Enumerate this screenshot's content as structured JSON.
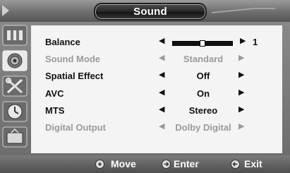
{
  "window": {
    "title": "Sound"
  },
  "sidebar": {
    "icons": [
      {
        "name": "picture-icon"
      },
      {
        "name": "sound-icon",
        "active": true
      },
      {
        "name": "setup-tools-icon"
      },
      {
        "name": "clock-icon"
      },
      {
        "name": "tv-icon"
      }
    ]
  },
  "menu": {
    "balance": {
      "label": "Balance",
      "value": "1",
      "level": 0.5
    },
    "items": [
      {
        "label": "Sound Mode",
        "value": "Standard",
        "enabled": false
      },
      {
        "label": "Spatial Effect",
        "value": "Off",
        "enabled": true
      },
      {
        "label": "AVC",
        "value": "On",
        "enabled": true
      },
      {
        "label": "MTS",
        "value": "Stereo",
        "enabled": true
      },
      {
        "label": "Digital Output",
        "value": "Dolby Digital",
        "enabled": false
      }
    ],
    "arrow_left": "◀",
    "arrow_right": "▶"
  },
  "footer": {
    "move_label": "Move",
    "enter_label": "Enter",
    "exit_label": "Exit"
  },
  "colors": {
    "panel": "#f4f4f4",
    "frame": "#5a5a5a",
    "disabled_text": "#9a9a9a"
  }
}
